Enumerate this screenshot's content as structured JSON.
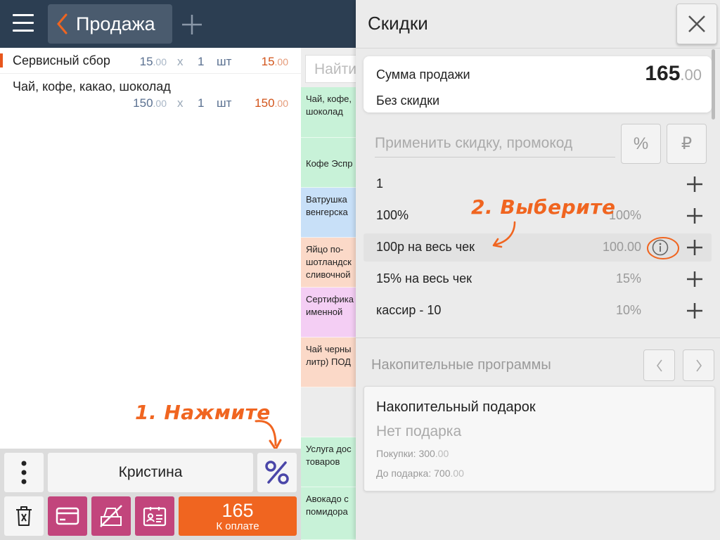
{
  "header": {
    "title": "Продажа"
  },
  "receipt": {
    "items": [
      {
        "name": "Сервисный сбор",
        "price": "15",
        "price_cents": ".00",
        "x": "x",
        "qty": "1",
        "unit": "шт",
        "total": "15",
        "total_cents": ".00"
      },
      {
        "name": "Чай, кофе, какао, шоколад",
        "price": "150",
        "price_cents": ".00",
        "x": "x",
        "qty": "1",
        "unit": "шт",
        "total": "150",
        "total_cents": ".00"
      }
    ]
  },
  "catalog": {
    "search_placeholder": "Найти",
    "tiles": [
      {
        "line1": "Чай, кофе,",
        "line2": "шоколад",
        "line3": "",
        "color": "#c8f2d8"
      },
      {
        "line1": "Кофе Эспр",
        "line2": "",
        "line3": "",
        "color": "#c8f2d8"
      },
      {
        "line1": "Ватрушка",
        "line2": "венгерска",
        "line3": "",
        "color": "#c8e0f8"
      },
      {
        "line1": "Яйцо по-",
        "line2": "шотландск",
        "line3": "сливочной",
        "color": "#fbd9c8"
      },
      {
        "line1": "Сертифика",
        "line2": "именной",
        "line3": "",
        "color": "#f4cef4"
      },
      {
        "line1": "Чай черны",
        "line2": "литр) ПОД",
        "line3": "",
        "color": "#fbd9c8"
      },
      {
        "line1": "",
        "line2": "",
        "line3": "",
        "color": "#ececec"
      },
      {
        "line1": "Услуга дос",
        "line2": "товаров",
        "line3": "",
        "color": "#c8f2d8"
      },
      {
        "line1": "Авокадо с",
        "line2": "помидора",
        "line3": "",
        "color": "#c8f2d8"
      }
    ]
  },
  "bottombar": {
    "cashier": "Кристина",
    "pay_amount": "165",
    "pay_label": "К оплате"
  },
  "annotations": {
    "step1": "1. Нажмите",
    "step2": "2. Выберите"
  },
  "discounts": {
    "title": "Скидки",
    "sum_label": "Сумма продажи",
    "sum_value": "165",
    "sum_cents": ".00",
    "sum_sub": "Без скидки",
    "promo_placeholder": "Применить скидку, промокод",
    "percent_btn": "%",
    "rub_btn": "₽",
    "items": [
      {
        "name": "1",
        "value": ""
      },
      {
        "name": "100%",
        "value": "100%"
      },
      {
        "name": "100р на весь чек",
        "value": "100.00"
      },
      {
        "name": "15% на весь чек",
        "value": "15%"
      },
      {
        "name": "кассир - 10",
        "value": "10%"
      }
    ]
  },
  "loyalty": {
    "title": "Накопительные программы",
    "card_title": "Накопительный подарок",
    "card_status": "Нет подарка",
    "purchases_label": "Покупки:",
    "purchases_value": "300",
    "purchases_cents": ".00",
    "until_gift_label": "До подарка:",
    "until_gift_value": "700",
    "until_gift_cents": ".00"
  },
  "colors": {
    "topbar": "#2c3e52",
    "accent_orange": "#f06520",
    "purple_buttons": "#c2457c",
    "total_red": "#d2541a"
  }
}
